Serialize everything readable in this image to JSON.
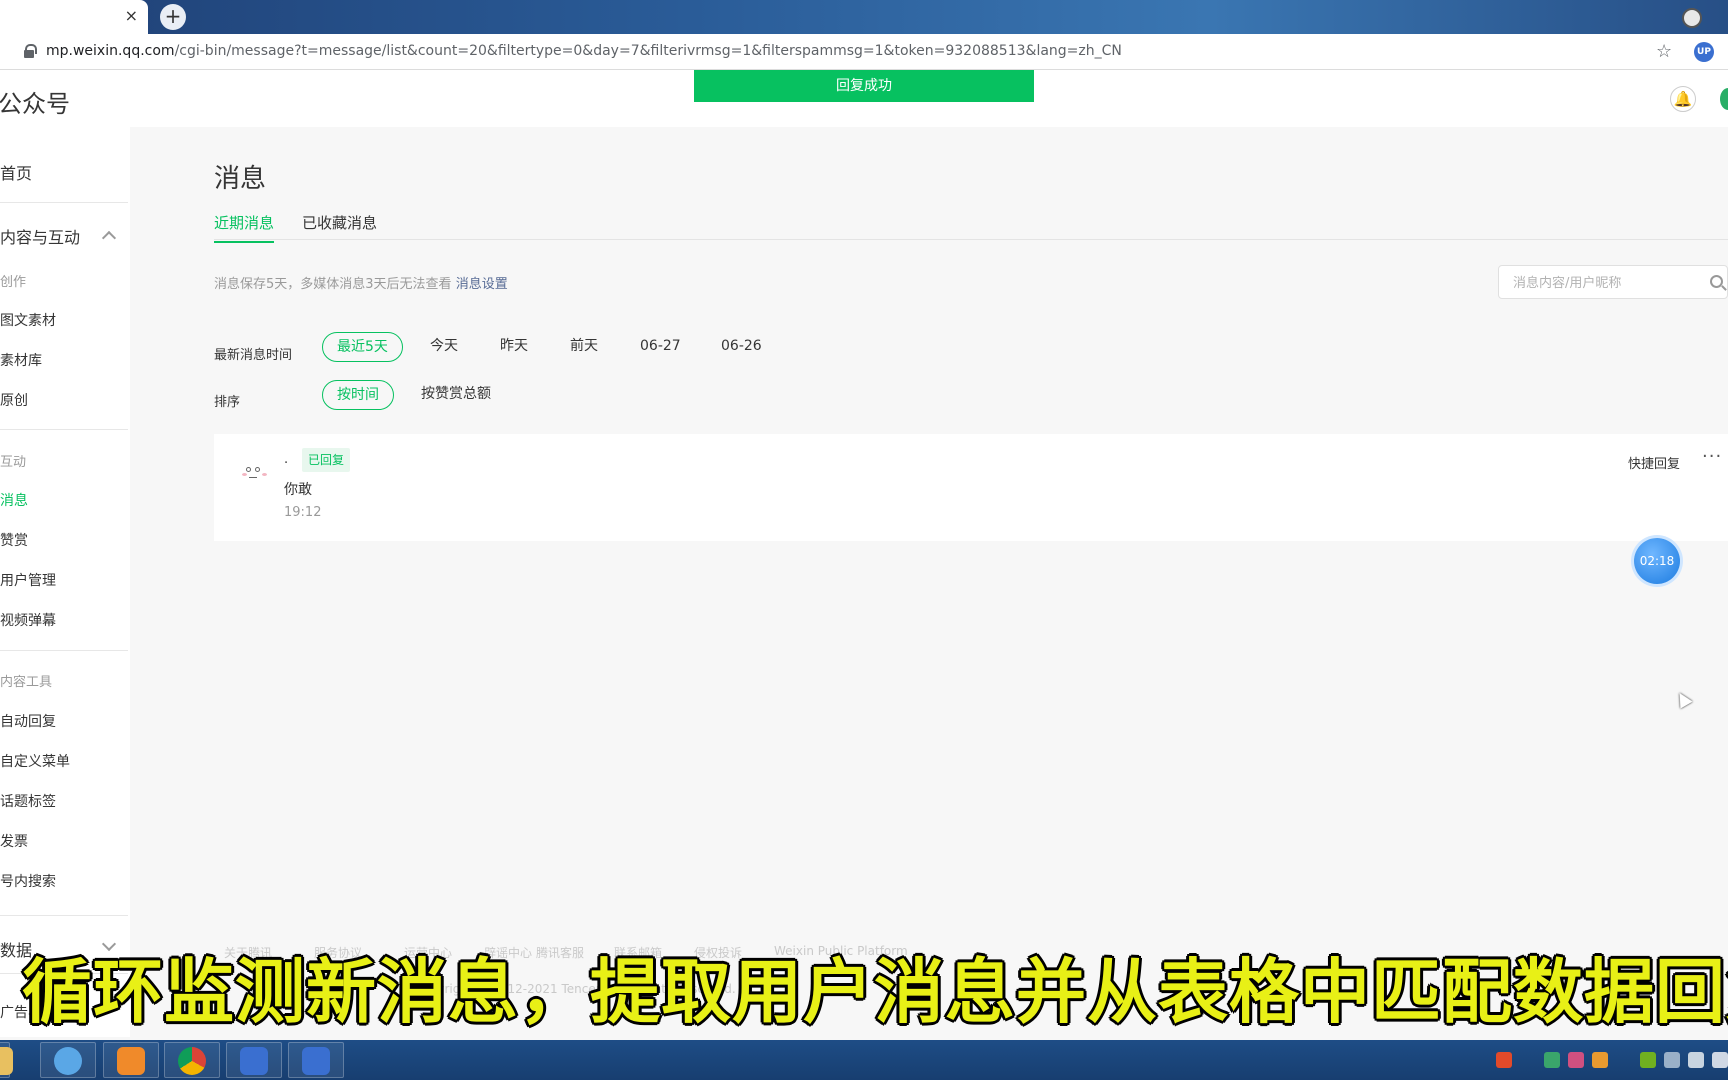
{
  "browser": {
    "tab_close": "×",
    "new_tab": "+",
    "url_host": "mp.weixin.qq.com",
    "url_path": "/cgi-bin/message?t=message/list&count=20&filtertype=0&day=7&filterivrmsg=1&filterspammsg=1&token=932088513&lang=zh_CN",
    "bookmark_star": "☆",
    "profile_label": "UP"
  },
  "header": {
    "brand": "公众号",
    "toast": "回复成功",
    "bell": "🔔"
  },
  "sidebar": {
    "home": "首页",
    "content_group": "内容与互动",
    "create_cat": "创作",
    "items_create": [
      "图文素材",
      "素材库",
      "原创"
    ],
    "interact_cat": "互动",
    "items_interact": [
      "消息",
      "赞赏",
      "用户管理",
      "视频弹幕"
    ],
    "tools_cat": "内容工具",
    "items_tools": [
      "自动回复",
      "自定义菜单",
      "话题标签",
      "发票",
      "号内搜索"
    ],
    "data_group": "数据",
    "ads_group": "广告与服务"
  },
  "main": {
    "title": "消息",
    "tabs": [
      "近期消息",
      "已收藏消息"
    ],
    "notice": "消息保存5天，多媒体消息3天后无法查看",
    "notice_link": "消息设置",
    "search_placeholder": "消息内容/用户昵称",
    "filter_label": "最新消息时间",
    "filter_chips": [
      "最近5天",
      "今天",
      "昨天",
      "前天",
      "06-27",
      "06-26"
    ],
    "sort_label": "排序",
    "sort_chips": [
      "按时间",
      "按赞赏总额"
    ]
  },
  "message": {
    "nickname": "·",
    "badge": "已回复",
    "text": "你敢",
    "time": "19:12",
    "quick_reply": "快捷回复",
    "more": "···"
  },
  "timer": "02:18",
  "footer": {
    "links": [
      "关于腾讯",
      "服务协议",
      "运营中心",
      "辟谣中心",
      "腾讯客服",
      "联系邮箱",
      "侵权投诉",
      "Weixin Public Platform"
    ],
    "copyright": "Copyright © 2012-2021 Tencent. All Rights Reserved."
  },
  "subtitle": "循环监测新消息，提取用户消息并从表格中匹配数据回复",
  "colors": {
    "accent": "#07c160",
    "link": "#576b95",
    "subtitle": "#e8f016"
  }
}
